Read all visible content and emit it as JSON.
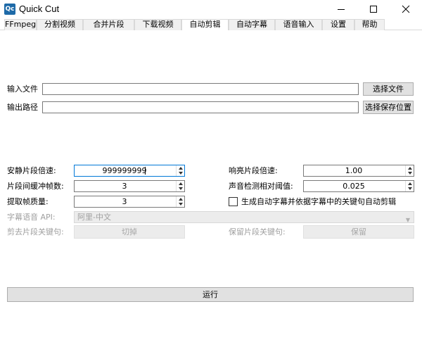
{
  "window": {
    "icon_text": "Qc",
    "title": "Quick Cut"
  },
  "tabs": [
    {
      "label": "FFmpeg",
      "active": false
    },
    {
      "label": "分割视频",
      "active": false
    },
    {
      "label": "合并片段",
      "active": false
    },
    {
      "label": "下载视频",
      "active": false
    },
    {
      "label": "自动剪辑",
      "active": true
    },
    {
      "label": "自动字幕",
      "active": false
    },
    {
      "label": "语音输入",
      "active": false
    },
    {
      "label": "设置",
      "active": false
    },
    {
      "label": "帮助",
      "active": false
    }
  ],
  "files": {
    "input_label": "输入文件",
    "input_value": "",
    "input_button": "选择文件",
    "output_label": "输出路径",
    "output_value": "",
    "output_button": "选择保存位置"
  },
  "params": {
    "silent_speed_label": "安静片段倍速:",
    "silent_speed_value": "999999999",
    "loud_speed_label": "响亮片段倍速:",
    "loud_speed_value": "1.00",
    "buffer_frames_label": "片段间缓冲帧数:",
    "buffer_frames_value": "3",
    "threshold_label": "声音检测相对阈值:",
    "threshold_value": "0.025",
    "frame_quality_label": "提取帧质量:",
    "frame_quality_value": "3",
    "auto_subtitle_checkbox_label": "生成自动字幕并依据字幕中的关键句自动剪辑",
    "auto_subtitle_checked": false,
    "subtitle_api_label": "字幕语音 API:",
    "subtitle_api_selected": "阿里-中文",
    "cut_keyword_label": "剪去片段关键句:",
    "cut_keyword_value": "切掉",
    "keep_keyword_label": "保留片段关键句:",
    "keep_keyword_value": "保留"
  },
  "run_button": "运行",
  "icons": {
    "minimize": "minimize-icon",
    "maximize": "maximize-icon",
    "close": "close-icon",
    "combo_arrow": "chevron-down-icon"
  },
  "colors": {
    "accent": "#0078d7",
    "button_bg": "#e1e1e1",
    "disabled_text": "#a0a0a0",
    "app_icon": "#1e6aa8"
  }
}
